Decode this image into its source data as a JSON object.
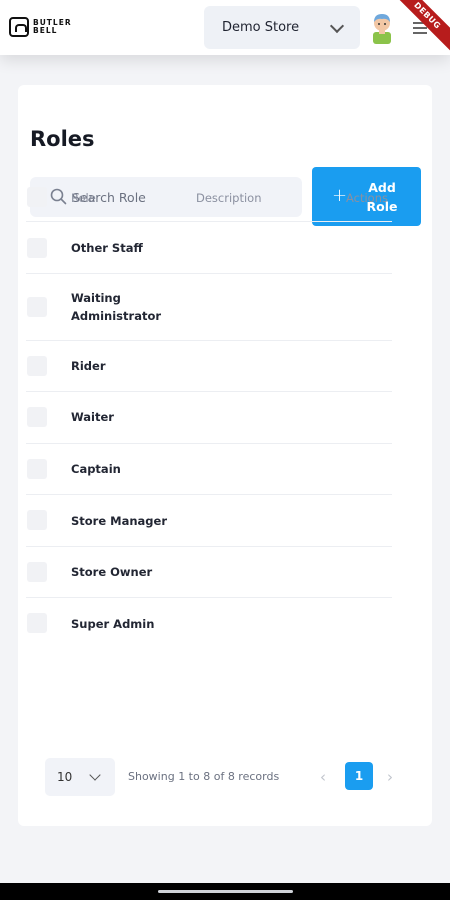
{
  "header": {
    "logo_text": "BUTLER BELL",
    "store": "Demo Store",
    "debug_label": "DEBUG"
  },
  "page": {
    "title": "Roles",
    "search_placeholder": "Search Role",
    "add_button": "Add Role"
  },
  "table": {
    "columns": [
      "Role",
      "Description",
      "Actions"
    ],
    "rows": [
      {
        "role": "Other Staff"
      },
      {
        "role": "Waiting Administrator"
      },
      {
        "role": "Rider"
      },
      {
        "role": "Waiter"
      },
      {
        "role": "Captain"
      },
      {
        "role": "Store Manager"
      },
      {
        "role": "Store Owner"
      },
      {
        "role": "Super Admin"
      }
    ]
  },
  "pagination": {
    "page_size": "10",
    "showing": "Showing 1 to 8 of 8 records",
    "current_page": "1",
    "prev": "‹",
    "next": "›"
  },
  "colors": {
    "accent": "#1a9df0",
    "debug": "#b71c1c"
  },
  "icons": [
    "logo-icon",
    "chevron-down-icon",
    "avatar",
    "menu-icon",
    "search-icon",
    "plus-icon",
    "chevron-left-icon",
    "chevron-right-icon"
  ]
}
